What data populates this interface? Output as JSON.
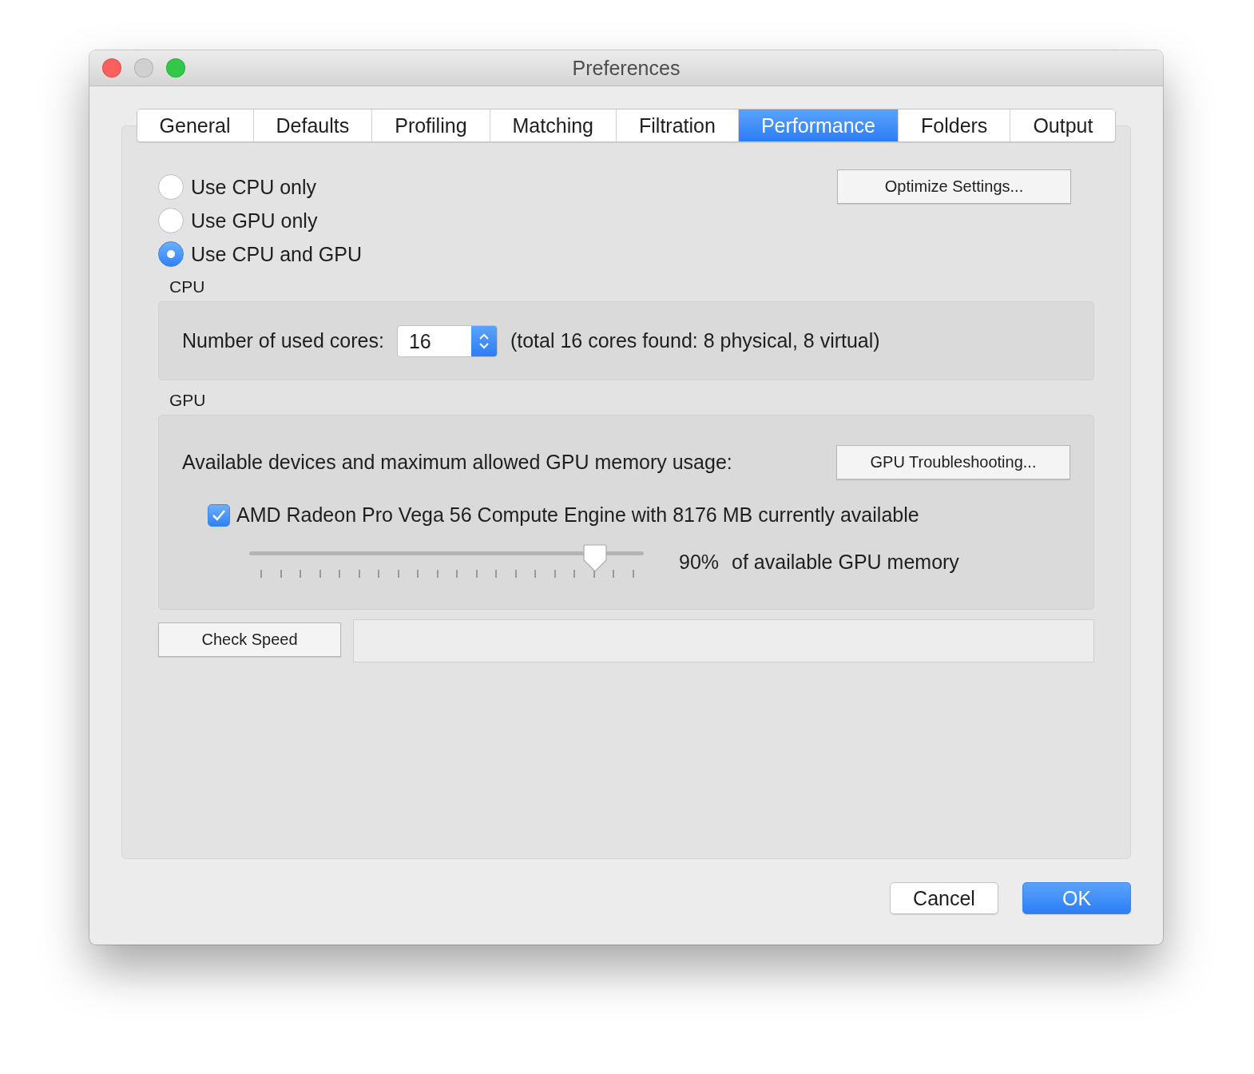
{
  "window": {
    "title": "Preferences"
  },
  "tabs": [
    {
      "label": "General",
      "selected": false
    },
    {
      "label": "Defaults",
      "selected": false
    },
    {
      "label": "Profiling",
      "selected": false
    },
    {
      "label": "Matching",
      "selected": false
    },
    {
      "label": "Filtration",
      "selected": false
    },
    {
      "label": "Performance",
      "selected": true
    },
    {
      "label": "Folders",
      "selected": false
    },
    {
      "label": "Output",
      "selected": false
    }
  ],
  "modes": [
    {
      "label": "Use CPU only",
      "selected": false
    },
    {
      "label": "Use GPU only",
      "selected": false
    },
    {
      "label": "Use CPU and GPU",
      "selected": true
    }
  ],
  "optimize_button": "Optimize Settings...",
  "cpu": {
    "title": "CPU",
    "cores_label": "Number of used cores:",
    "cores_value": "16",
    "cores_note": "(total 16 cores found: 8 physical, 8 virtual)"
  },
  "gpu": {
    "title": "GPU",
    "devices_label": "Available devices and maximum allowed GPU memory usage:",
    "troubleshoot_button": "GPU Troubleshooting...",
    "device": {
      "label": "AMD Radeon Pro Vega 56 Compute Engine with 8176 MB currently available",
      "checked": true
    },
    "memory": {
      "level": 0.9,
      "percent": "90%",
      "label": "of available GPU memory"
    }
  },
  "check_speed_button": "Check Speed",
  "buttons": {
    "cancel": "Cancel",
    "ok": "OK"
  }
}
